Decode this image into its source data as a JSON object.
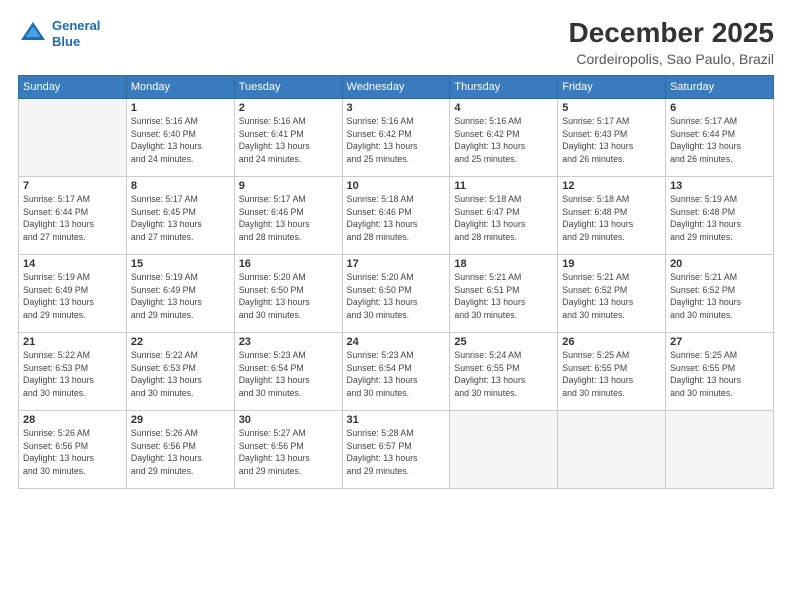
{
  "header": {
    "logo_line1": "General",
    "logo_line2": "Blue",
    "title": "December 2025",
    "subtitle": "Cordeiropolis, Sao Paulo, Brazil"
  },
  "calendar": {
    "days_of_week": [
      "Sunday",
      "Monday",
      "Tuesday",
      "Wednesday",
      "Thursday",
      "Friday",
      "Saturday"
    ],
    "weeks": [
      [
        {
          "day": "",
          "info": "",
          "empty": true
        },
        {
          "day": "1",
          "info": "Sunrise: 5:16 AM\nSunset: 6:40 PM\nDaylight: 13 hours\nand 24 minutes."
        },
        {
          "day": "2",
          "info": "Sunrise: 5:16 AM\nSunset: 6:41 PM\nDaylight: 13 hours\nand 24 minutes."
        },
        {
          "day": "3",
          "info": "Sunrise: 5:16 AM\nSunset: 6:42 PM\nDaylight: 13 hours\nand 25 minutes."
        },
        {
          "day": "4",
          "info": "Sunrise: 5:16 AM\nSunset: 6:42 PM\nDaylight: 13 hours\nand 25 minutes."
        },
        {
          "day": "5",
          "info": "Sunrise: 5:17 AM\nSunset: 6:43 PM\nDaylight: 13 hours\nand 26 minutes."
        },
        {
          "day": "6",
          "info": "Sunrise: 5:17 AM\nSunset: 6:44 PM\nDaylight: 13 hours\nand 26 minutes."
        }
      ],
      [
        {
          "day": "7",
          "info": "Sunrise: 5:17 AM\nSunset: 6:44 PM\nDaylight: 13 hours\nand 27 minutes."
        },
        {
          "day": "8",
          "info": "Sunrise: 5:17 AM\nSunset: 6:45 PM\nDaylight: 13 hours\nand 27 minutes."
        },
        {
          "day": "9",
          "info": "Sunrise: 5:17 AM\nSunset: 6:46 PM\nDaylight: 13 hours\nand 28 minutes."
        },
        {
          "day": "10",
          "info": "Sunrise: 5:18 AM\nSunset: 6:46 PM\nDaylight: 13 hours\nand 28 minutes."
        },
        {
          "day": "11",
          "info": "Sunrise: 5:18 AM\nSunset: 6:47 PM\nDaylight: 13 hours\nand 28 minutes."
        },
        {
          "day": "12",
          "info": "Sunrise: 5:18 AM\nSunset: 6:48 PM\nDaylight: 13 hours\nand 29 minutes."
        },
        {
          "day": "13",
          "info": "Sunrise: 5:19 AM\nSunset: 6:48 PM\nDaylight: 13 hours\nand 29 minutes."
        }
      ],
      [
        {
          "day": "14",
          "info": "Sunrise: 5:19 AM\nSunset: 6:49 PM\nDaylight: 13 hours\nand 29 minutes."
        },
        {
          "day": "15",
          "info": "Sunrise: 5:19 AM\nSunset: 6:49 PM\nDaylight: 13 hours\nand 29 minutes."
        },
        {
          "day": "16",
          "info": "Sunrise: 5:20 AM\nSunset: 6:50 PM\nDaylight: 13 hours\nand 30 minutes."
        },
        {
          "day": "17",
          "info": "Sunrise: 5:20 AM\nSunset: 6:50 PM\nDaylight: 13 hours\nand 30 minutes."
        },
        {
          "day": "18",
          "info": "Sunrise: 5:21 AM\nSunset: 6:51 PM\nDaylight: 13 hours\nand 30 minutes."
        },
        {
          "day": "19",
          "info": "Sunrise: 5:21 AM\nSunset: 6:52 PM\nDaylight: 13 hours\nand 30 minutes."
        },
        {
          "day": "20",
          "info": "Sunrise: 5:21 AM\nSunset: 6:52 PM\nDaylight: 13 hours\nand 30 minutes."
        }
      ],
      [
        {
          "day": "21",
          "info": "Sunrise: 5:22 AM\nSunset: 6:53 PM\nDaylight: 13 hours\nand 30 minutes."
        },
        {
          "day": "22",
          "info": "Sunrise: 5:22 AM\nSunset: 6:53 PM\nDaylight: 13 hours\nand 30 minutes."
        },
        {
          "day": "23",
          "info": "Sunrise: 5:23 AM\nSunset: 6:54 PM\nDaylight: 13 hours\nand 30 minutes."
        },
        {
          "day": "24",
          "info": "Sunrise: 5:23 AM\nSunset: 6:54 PM\nDaylight: 13 hours\nand 30 minutes."
        },
        {
          "day": "25",
          "info": "Sunrise: 5:24 AM\nSunset: 6:55 PM\nDaylight: 13 hours\nand 30 minutes."
        },
        {
          "day": "26",
          "info": "Sunrise: 5:25 AM\nSunset: 6:55 PM\nDaylight: 13 hours\nand 30 minutes."
        },
        {
          "day": "27",
          "info": "Sunrise: 5:25 AM\nSunset: 6:55 PM\nDaylight: 13 hours\nand 30 minutes."
        }
      ],
      [
        {
          "day": "28",
          "info": "Sunrise: 5:26 AM\nSunset: 6:56 PM\nDaylight: 13 hours\nand 30 minutes."
        },
        {
          "day": "29",
          "info": "Sunrise: 5:26 AM\nSunset: 6:56 PM\nDaylight: 13 hours\nand 29 minutes."
        },
        {
          "day": "30",
          "info": "Sunrise: 5:27 AM\nSunset: 6:56 PM\nDaylight: 13 hours\nand 29 minutes."
        },
        {
          "day": "31",
          "info": "Sunrise: 5:28 AM\nSunset: 6:57 PM\nDaylight: 13 hours\nand 29 minutes."
        },
        {
          "day": "",
          "info": "",
          "empty": true
        },
        {
          "day": "",
          "info": "",
          "empty": true
        },
        {
          "day": "",
          "info": "",
          "empty": true
        }
      ]
    ]
  }
}
